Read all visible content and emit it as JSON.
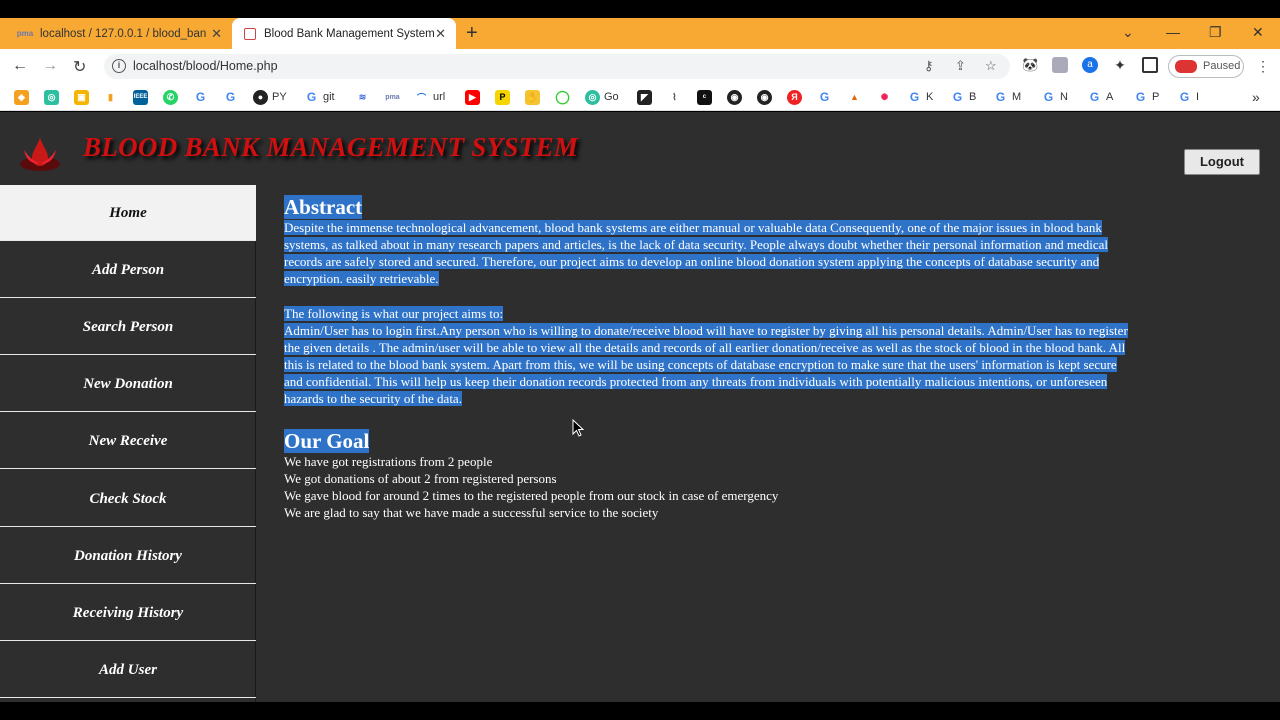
{
  "browser": {
    "tabs": [
      {
        "title": "localhost / 127.0.0.1 / blood_ban",
        "favicon": "phpmyadmin-icon",
        "active": false
      },
      {
        "title": "Blood Bank Management System",
        "favicon": "globe-icon",
        "active": true
      }
    ],
    "url": "localhost/blood/Home.php",
    "profile_status": "Paused",
    "bookmarks": [
      {
        "label": "PY"
      },
      {
        "label": "git"
      },
      {
        "label": "url"
      },
      {
        "label": "Go"
      },
      {
        "label": "K"
      },
      {
        "label": "B"
      },
      {
        "label": "M"
      },
      {
        "label": "N"
      },
      {
        "label": "A"
      },
      {
        "label": "P"
      },
      {
        "label": "I"
      }
    ]
  },
  "site": {
    "title": "BLOOD BANK MANAGEMENT SYSTEM",
    "logout_label": "Logout",
    "colors": {
      "title": "#d01010",
      "background": "#2e2e2e",
      "selection": "#2f73c8"
    }
  },
  "sidebar": {
    "items": [
      {
        "label": "Home",
        "active": true
      },
      {
        "label": "Add Person"
      },
      {
        "label": "Search Person"
      },
      {
        "label": "New Donation"
      },
      {
        "label": "New Receive"
      },
      {
        "label": "Check Stock"
      },
      {
        "label": "Donation History"
      },
      {
        "label": "Receiving History"
      },
      {
        "label": "Add User"
      }
    ]
  },
  "main": {
    "abstract_heading": "Abstract",
    "abstract_lines": [
      "Despite the immense technological advancement, blood bank systems are either manual or valuable data Consequently, one of the major issues in blood bank",
      "systems, as talked about in many research papers and articles, is the lack of data security. People always doubt whether their personal information and medical",
      "records are safely stored and secured. Therefore, our project aims to develop an online blood donation system applying the concepts of database security and",
      "encryption. easily retrievable."
    ],
    "aims_intro": "The following is what our project aims to:",
    "aims_lines": [
      "Admin/User has to login first.Any person who is willing to donate/receive blood will have to register by giving all his personal details. Admin/User has to register",
      "the given details . The admin/user will be able to view all the details and records of all earlier donation/receive as well as the stock of blood in the blood bank. All",
      "this is related to the blood bank system. Apart from this, we will be using concepts of database encryption to make sure that the users' information is kept secure",
      "and confidential. This will help us keep their donation records protected from any threats from individuals with potentially malicious intentions, or unforeseen",
      "hazards to the security of the data."
    ],
    "goal_heading": "Our Goal",
    "goal_lines": [
      "We have got registrations from 2 people",
      "We got donations of about 2 from registered persons",
      "We gave blood for around 2 times to the registered people from our stock in case of emergency",
      "We are glad to say that we have made a successful service to the society"
    ]
  }
}
